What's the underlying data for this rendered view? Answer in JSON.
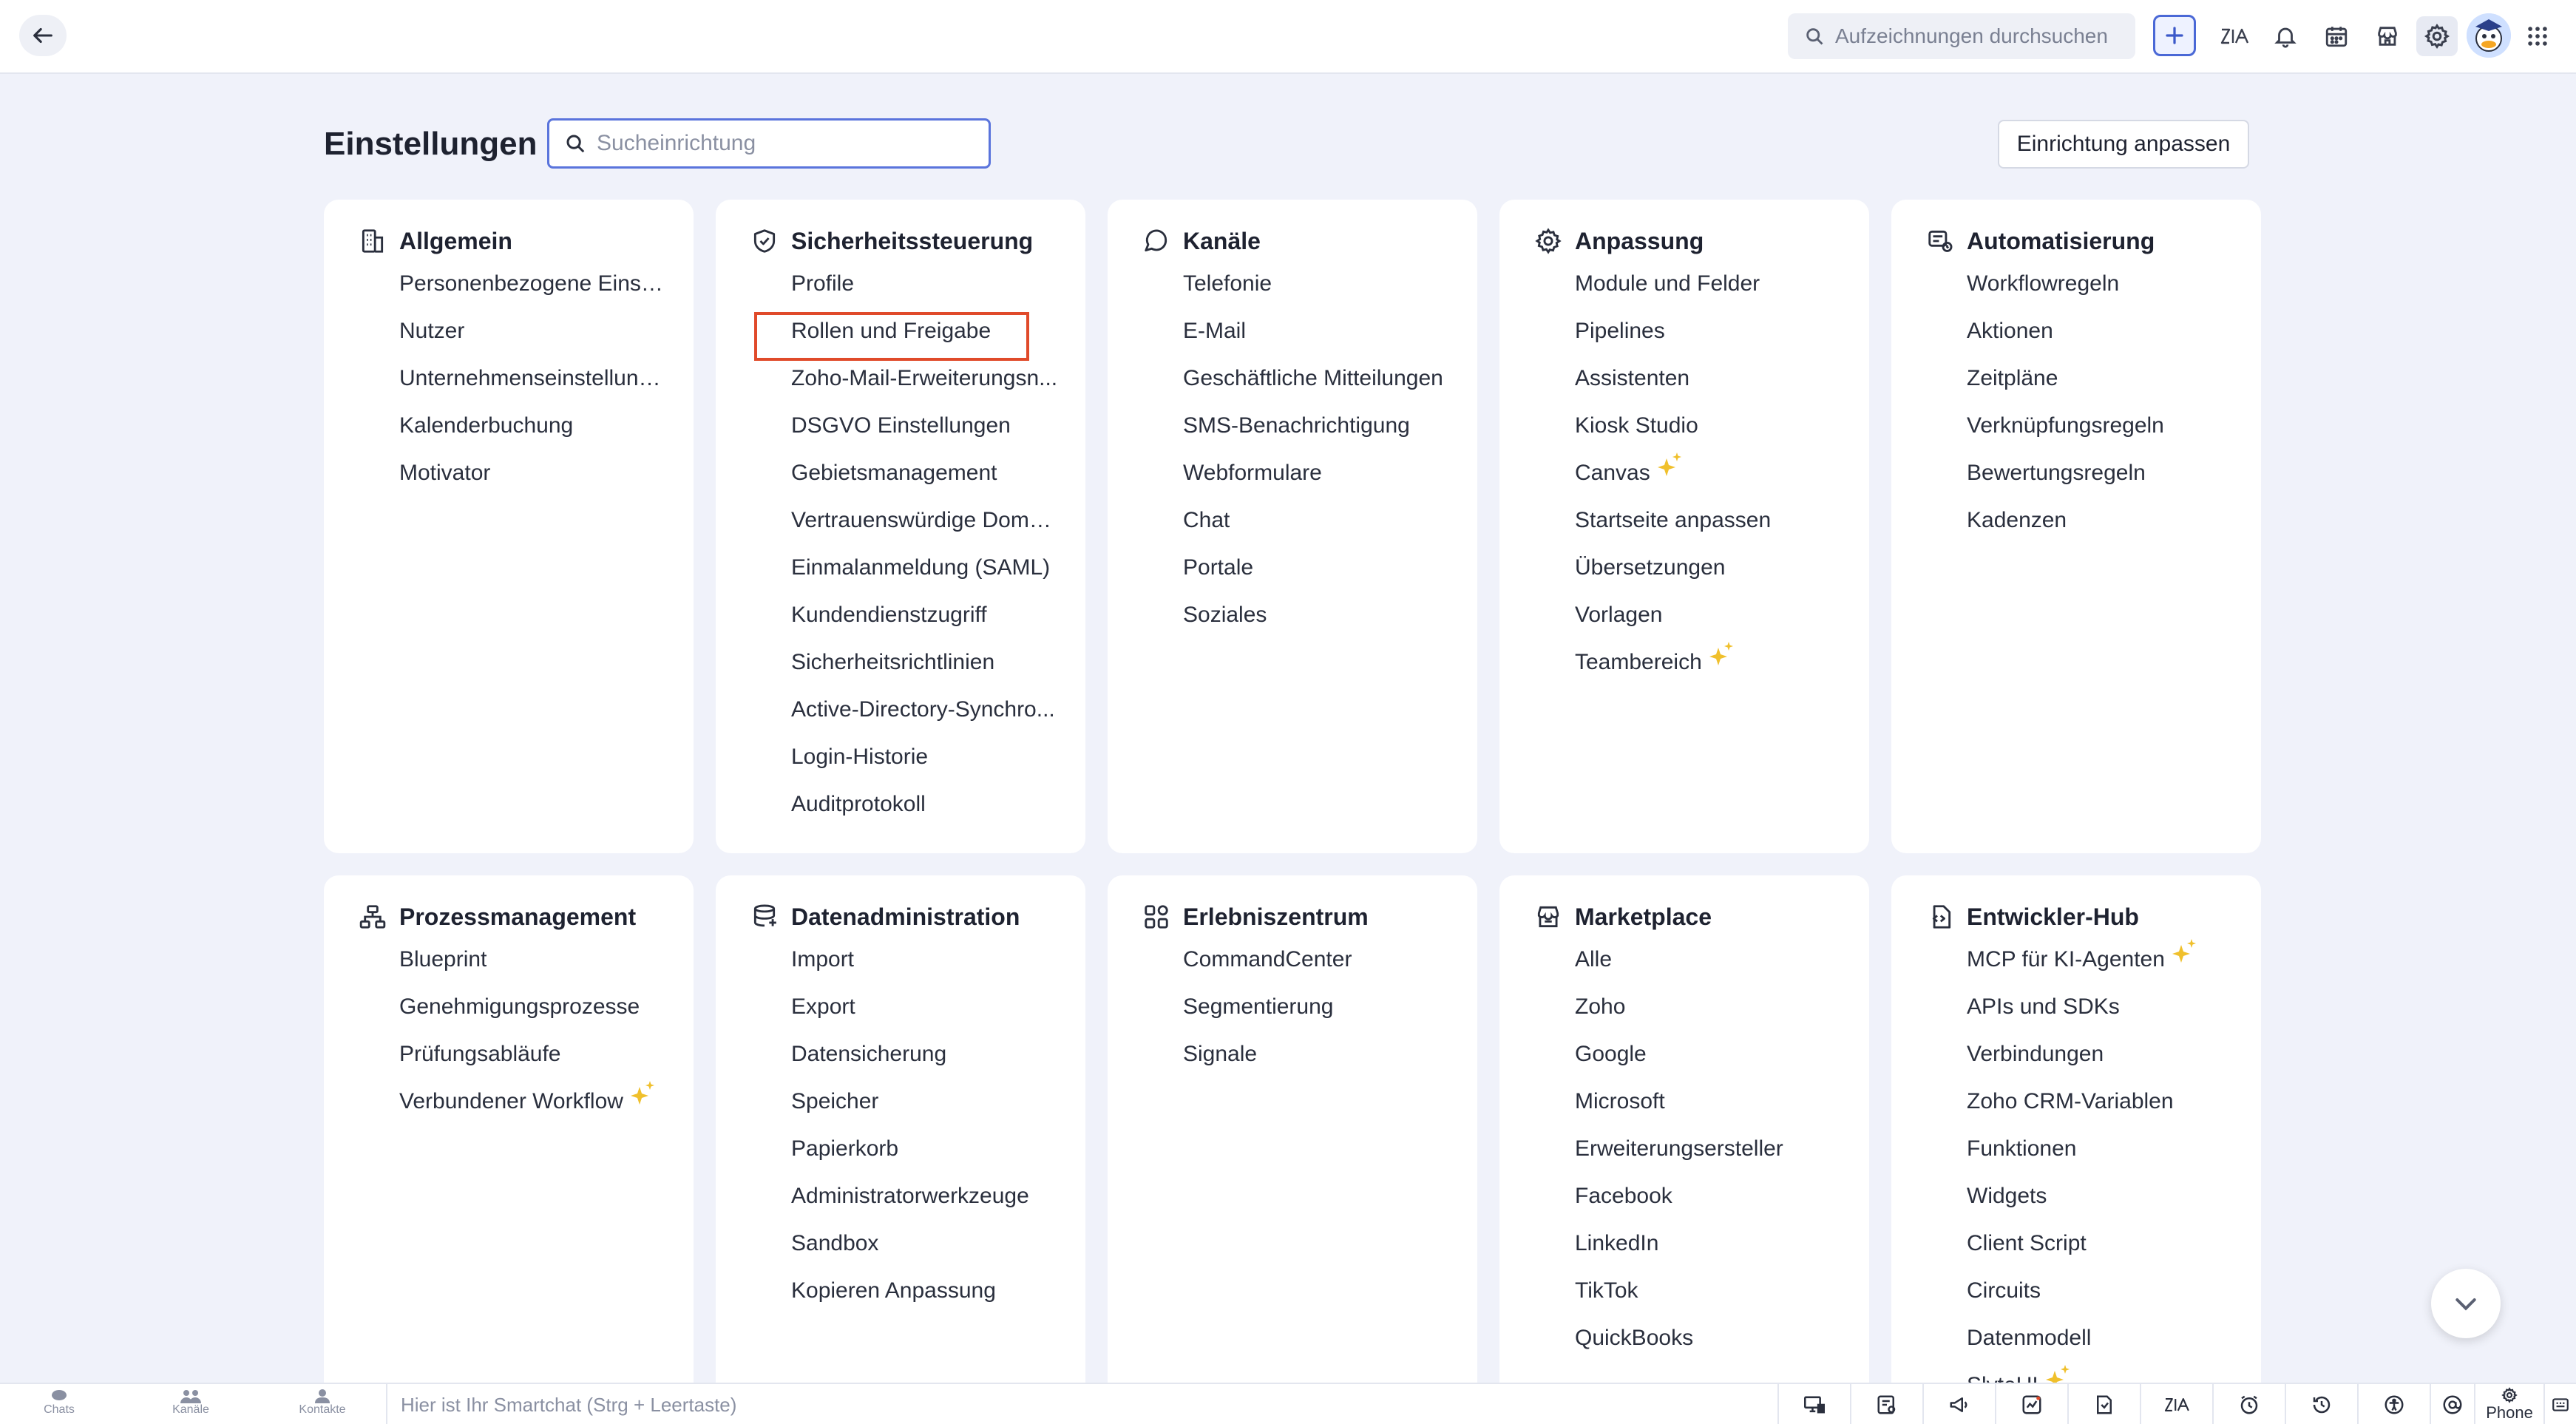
{
  "topbar": {
    "search_placeholder": "Aufzeichnungen durchsuchen"
  },
  "page": {
    "title": "Einstellungen",
    "search_placeholder": "Sucheinrichtung",
    "customize_label": "Einrichtung anpassen"
  },
  "cards": [
    {
      "title": "Allgemein",
      "icon": "building-icon",
      "items": [
        {
          "label": "Personenbezogene Einste..."
        },
        {
          "label": "Nutzer"
        },
        {
          "label": "Unternehmenseinstellung..."
        },
        {
          "label": "Kalenderbuchung"
        },
        {
          "label": "Motivator"
        }
      ]
    },
    {
      "title": "Sicherheitssteuerung",
      "icon": "shield-icon",
      "items": [
        {
          "label": "Profile"
        },
        {
          "label": "Rollen und Freigabe",
          "highlighted": true
        },
        {
          "label": "Zoho-Mail-Erweiterungsn..."
        },
        {
          "label": "DSGVO Einstellungen"
        },
        {
          "label": "Gebietsmanagement"
        },
        {
          "label": "Vertrauenswürdige Domäne"
        },
        {
          "label": "Einmalanmeldung (SAML)"
        },
        {
          "label": "Kundendienstzugriff"
        },
        {
          "label": "Sicherheitsrichtlinien"
        },
        {
          "label": "Active-Directory-Synchro..."
        },
        {
          "label": "Login-Historie"
        },
        {
          "label": "Auditprotokoll"
        }
      ]
    },
    {
      "title": "Kanäle",
      "icon": "chat-bubble-icon",
      "items": [
        {
          "label": "Telefonie"
        },
        {
          "label": "E-Mail"
        },
        {
          "label": "Geschäftliche Mitteilungen"
        },
        {
          "label": "SMS-Benachrichtigung"
        },
        {
          "label": "Webformulare"
        },
        {
          "label": "Chat"
        },
        {
          "label": "Portale"
        },
        {
          "label": "Soziales"
        }
      ]
    },
    {
      "title": "Anpassung",
      "icon": "gear-icon",
      "items": [
        {
          "label": "Module und Felder"
        },
        {
          "label": "Pipelines"
        },
        {
          "label": "Assistenten"
        },
        {
          "label": "Kiosk Studio"
        },
        {
          "label": "Canvas",
          "sparkle": true
        },
        {
          "label": "Startseite anpassen"
        },
        {
          "label": "Übersetzungen"
        },
        {
          "label": "Vorlagen"
        },
        {
          "label": "Teambereich",
          "sparkle": true
        }
      ]
    },
    {
      "title": "Automatisierung",
      "icon": "automation-icon",
      "items": [
        {
          "label": "Workflowregeln"
        },
        {
          "label": "Aktionen"
        },
        {
          "label": "Zeitpläne"
        },
        {
          "label": "Verknüpfungsregeln"
        },
        {
          "label": "Bewertungsregeln"
        },
        {
          "label": "Kadenzen"
        }
      ]
    },
    {
      "title": "Prozessmanagement",
      "icon": "process-tree-icon",
      "items": [
        {
          "label": "Blueprint"
        },
        {
          "label": "Genehmigungsprozesse"
        },
        {
          "label": "Prüfungsabläufe"
        },
        {
          "label": "Verbundener Workflow",
          "sparkle": true
        }
      ]
    },
    {
      "title": "Datenadministration",
      "icon": "database-icon",
      "items": [
        {
          "label": "Import"
        },
        {
          "label": "Export"
        },
        {
          "label": "Datensicherung"
        },
        {
          "label": "Speicher"
        },
        {
          "label": "Papierkorb"
        },
        {
          "label": "Administratorwerkzeuge"
        },
        {
          "label": "Sandbox"
        },
        {
          "label": "Kopieren Anpassung"
        }
      ]
    },
    {
      "title": "Erlebniszentrum",
      "icon": "grid-apps-icon",
      "items": [
        {
          "label": "CommandCenter"
        },
        {
          "label": "Segmentierung"
        },
        {
          "label": "Signale"
        }
      ]
    },
    {
      "title": "Marketplace",
      "icon": "store-icon",
      "items": [
        {
          "label": "Alle"
        },
        {
          "label": "Zoho"
        },
        {
          "label": "Google"
        },
        {
          "label": "Microsoft"
        },
        {
          "label": "Erweiterungsersteller"
        },
        {
          "label": "Facebook"
        },
        {
          "label": "LinkedIn"
        },
        {
          "label": "TikTok"
        },
        {
          "label": "QuickBooks"
        }
      ]
    },
    {
      "title": "Entwickler-Hub",
      "icon": "code-file-icon",
      "items": [
        {
          "label": "MCP für KI-Agenten",
          "sparkle": true
        },
        {
          "label": "APIs und SDKs"
        },
        {
          "label": "Verbindungen"
        },
        {
          "label": "Zoho CRM-Variablen"
        },
        {
          "label": "Funktionen"
        },
        {
          "label": "Widgets"
        },
        {
          "label": "Client Script"
        },
        {
          "label": "Circuits"
        },
        {
          "label": "Datenmodell"
        },
        {
          "label": "SlyteUI",
          "sparkle": true
        }
      ]
    }
  ],
  "bottombar": {
    "tabs": [
      "Chats",
      "Kanäle",
      "Kontakte"
    ],
    "smartchat_placeholder": "Hier ist Ihr Smartchat (Strg + Leertaste)",
    "phone_label": "Phone"
  }
}
